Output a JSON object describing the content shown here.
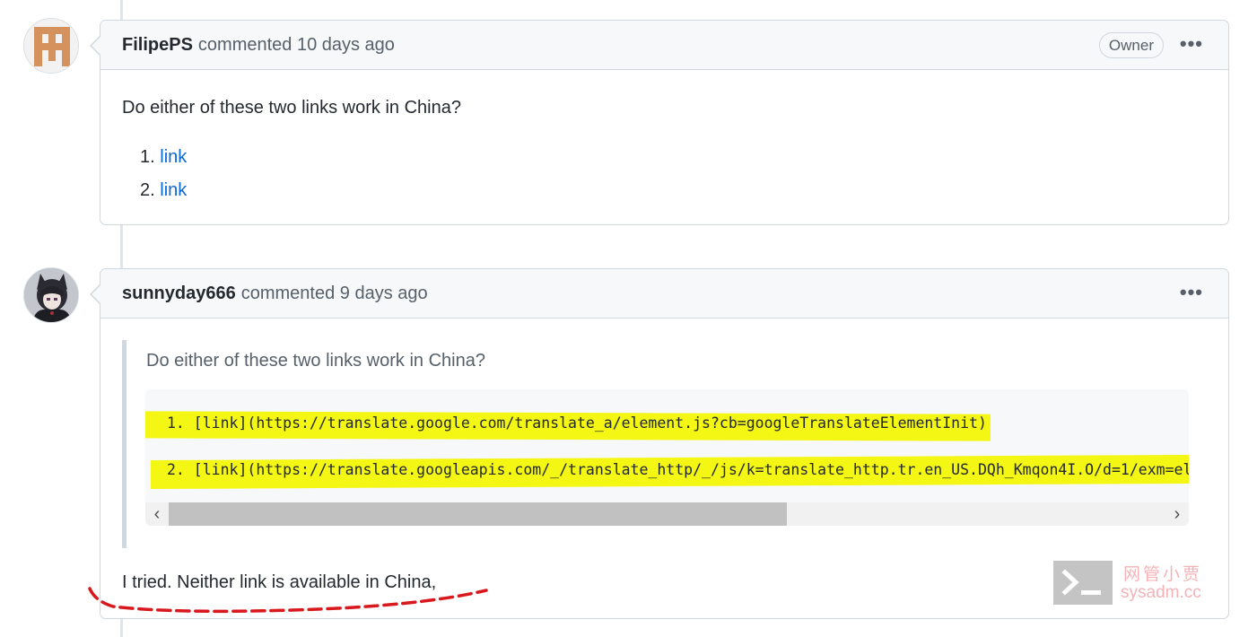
{
  "comments": [
    {
      "author": "FilipePS",
      "meta": "commented 10 days ago",
      "badge": "Owner",
      "body_text": "Do either of these two links work in China?",
      "links": [
        {
          "number": "1.",
          "label": "link"
        },
        {
          "number": "2.",
          "label": "link"
        }
      ]
    },
    {
      "author": "sunnyday666",
      "meta": "commented 9 days ago",
      "quote": {
        "text": "Do either of these two links work in China?",
        "code_lines": [
          "1. [link](https://translate.google.com/translate_a/element.js?cb=googleTranslateElementInit)",
          "2. [link](https://translate.googleapis.com/_/translate_http/_/js/k=translate_http.tr.en_US.DQh_Kmqon4I.O/d=1/exm=el_"
        ]
      },
      "reply": "I tried. Neither link is available in China,"
    }
  ],
  "watermark": {
    "cn": "网管小贾",
    "domain": "sysadm.cc"
  },
  "colors": {
    "highlight": "#f4f614",
    "link": "#0969da",
    "annotation_dash": "#d9181e"
  },
  "icons": {
    "menu": "kebab-horizontal",
    "scroll_left": "chevron-left",
    "scroll_right": "chevron-right",
    "watermark": "terminal-prompt"
  }
}
